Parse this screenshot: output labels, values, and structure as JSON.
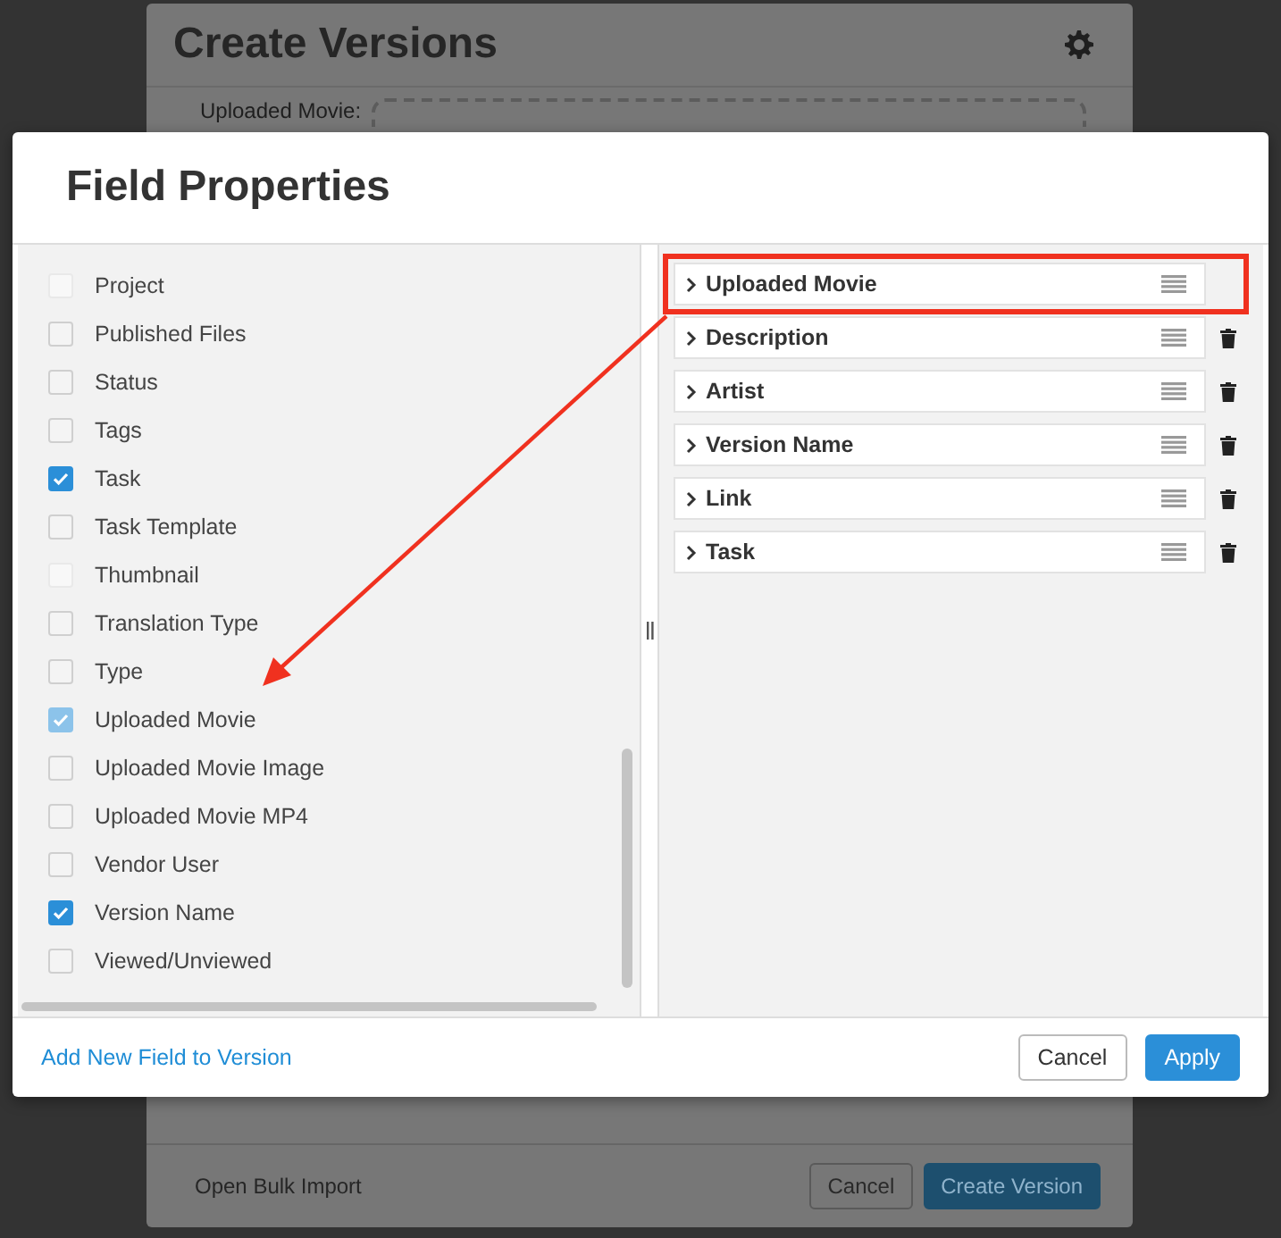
{
  "background_dialog": {
    "title": "Create Versions",
    "field_label": "Uploaded Movie:",
    "footer_link": "Open Bulk Import",
    "buttons": [
      {
        "label": "Cancel",
        "kind": "secondary"
      },
      {
        "label": "Create Version",
        "kind": "primary"
      }
    ]
  },
  "dialog": {
    "title": "Field Properties",
    "available_fields": [
      {
        "label": "Project",
        "checked": false,
        "disabled": true
      },
      {
        "label": "Published Files",
        "checked": false,
        "disabled": false
      },
      {
        "label": "Status",
        "checked": false,
        "disabled": false
      },
      {
        "label": "Tags",
        "checked": false,
        "disabled": false
      },
      {
        "label": "Task",
        "checked": true,
        "disabled": false
      },
      {
        "label": "Task Template",
        "checked": false,
        "disabled": false
      },
      {
        "label": "Thumbnail",
        "checked": false,
        "disabled": true
      },
      {
        "label": "Translation Type",
        "checked": false,
        "disabled": false
      },
      {
        "label": "Type",
        "checked": false,
        "disabled": false
      },
      {
        "label": "Uploaded Movie",
        "checked": true,
        "disabled": true
      },
      {
        "label": "Uploaded Movie Image",
        "checked": false,
        "disabled": false
      },
      {
        "label": "Uploaded Movie MP4",
        "checked": false,
        "disabled": false
      },
      {
        "label": "Vendor User",
        "checked": false,
        "disabled": false
      },
      {
        "label": "Version Name",
        "checked": true,
        "disabled": false
      },
      {
        "label": "Viewed/Unviewed",
        "checked": false,
        "disabled": false
      }
    ],
    "selected_fields": [
      {
        "label": "Uploaded Movie",
        "removable": false,
        "highlighted": true
      },
      {
        "label": "Description",
        "removable": true,
        "highlighted": false
      },
      {
        "label": "Artist",
        "removable": true,
        "highlighted": false
      },
      {
        "label": "Version Name",
        "removable": true,
        "highlighted": false
      },
      {
        "label": "Link",
        "removable": true,
        "highlighted": false
      },
      {
        "label": "Task",
        "removable": true,
        "highlighted": false
      }
    ],
    "add_field_link": "Add New Field to Version",
    "buttons": [
      {
        "label": "Cancel",
        "kind": "secondary"
      },
      {
        "label": "Apply",
        "kind": "primary"
      }
    ]
  }
}
